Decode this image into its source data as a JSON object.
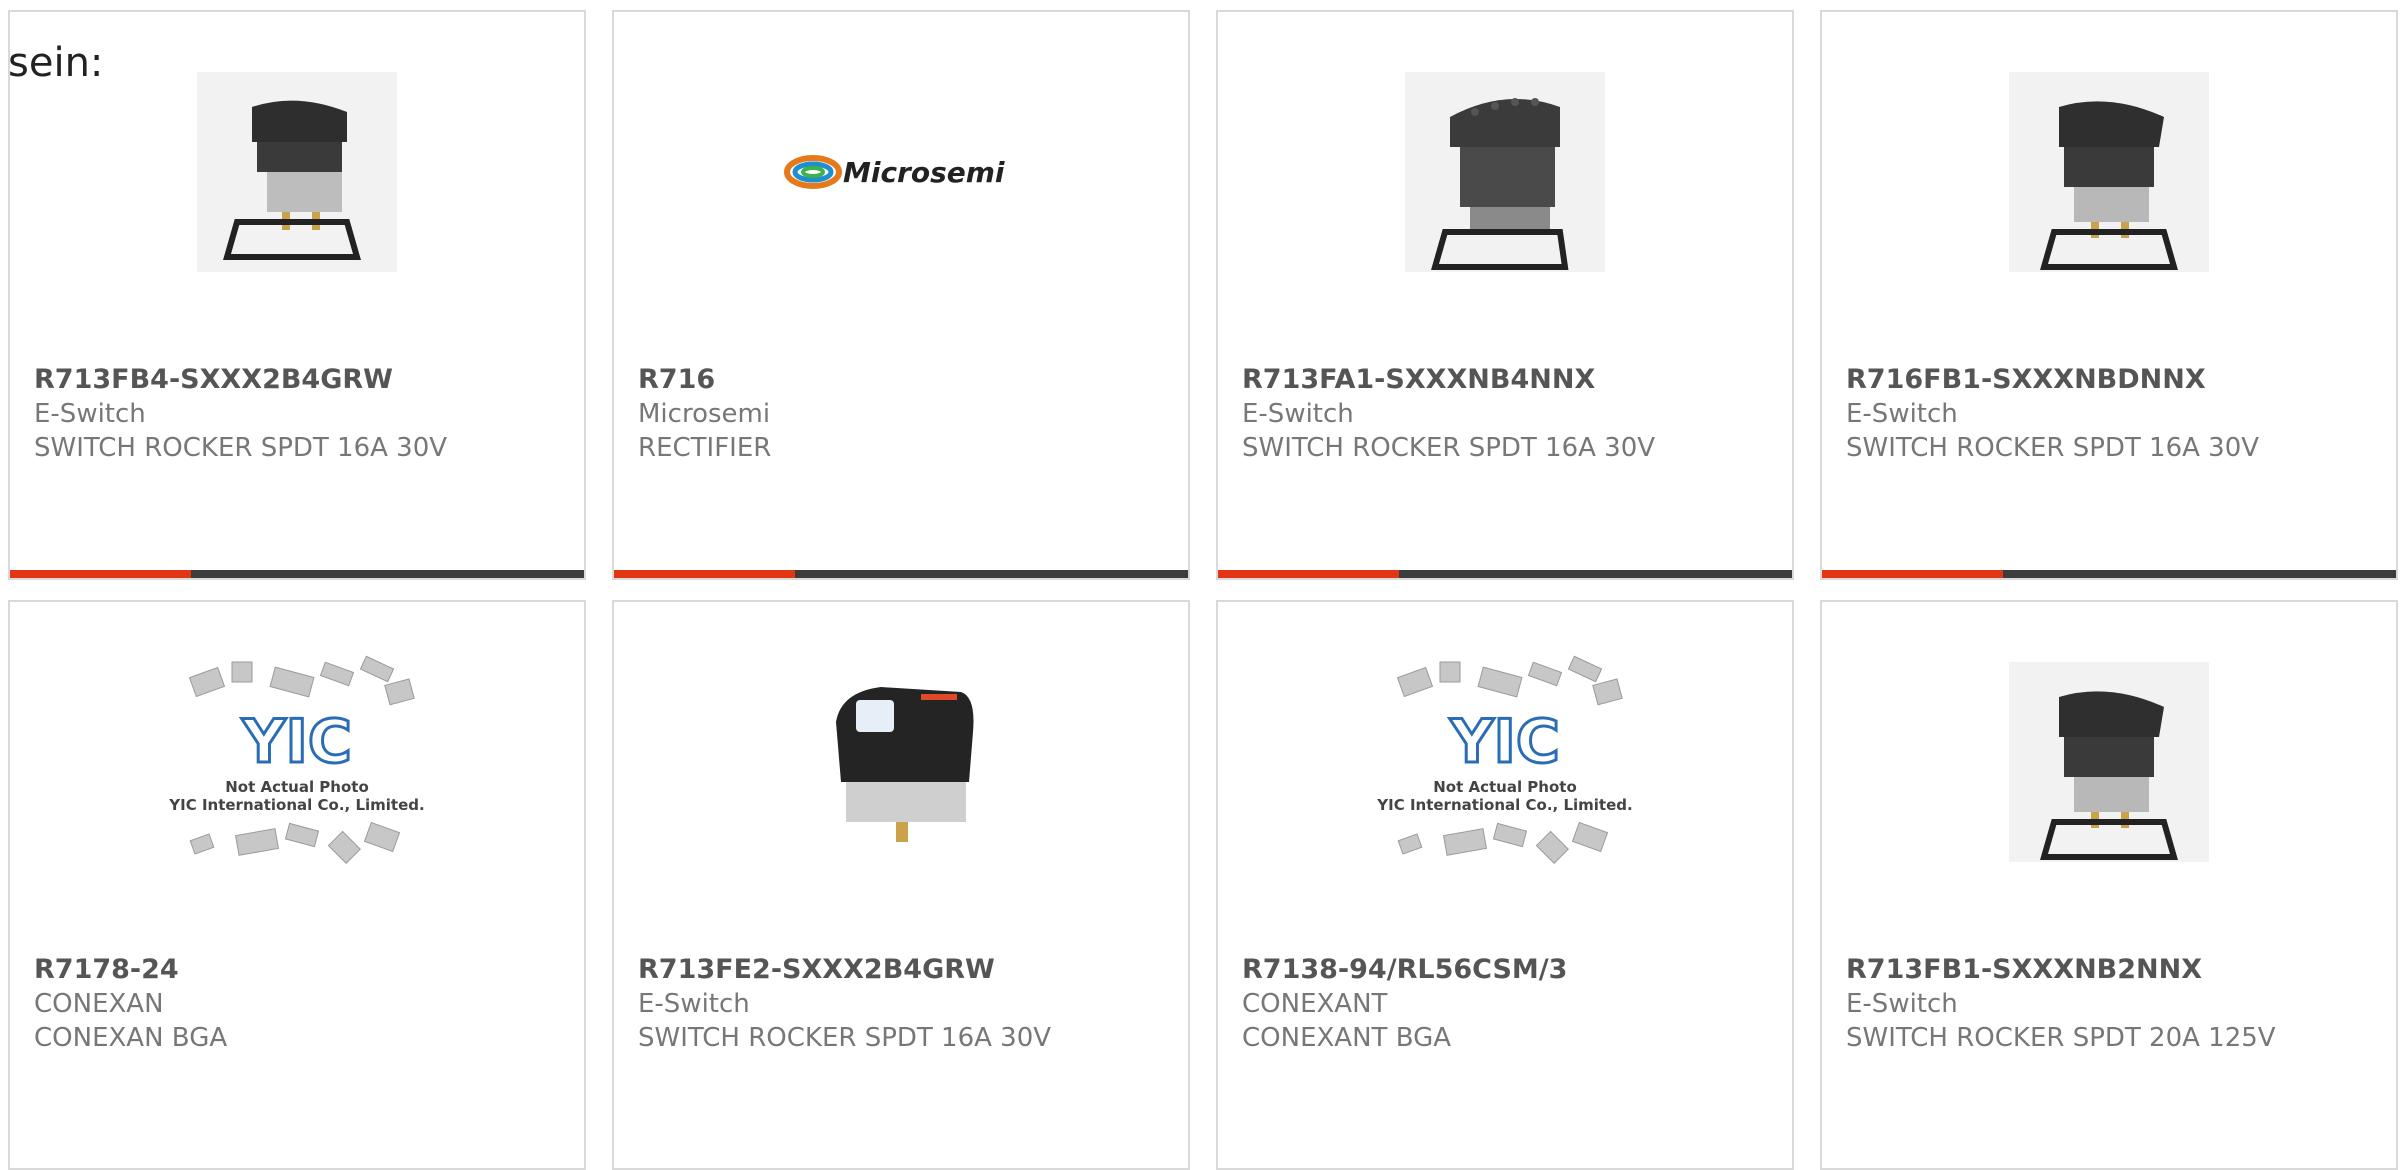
{
  "intro_text": "sein:",
  "colors": {
    "accent": "#e03614",
    "bar": "#3c3c3c",
    "border": "#d9d9d9"
  },
  "products": [
    {
      "part": "R713FB4-SXXX2B4GRW",
      "maker": "E-Switch",
      "desc": "SWITCH ROCKER SPDT 16A 30V",
      "image": "rocker-switch-with-gasket-icon"
    },
    {
      "part": "R716",
      "maker": "Microsemi",
      "desc": "RECTIFIER",
      "image": "microsemi-logo",
      "logo_text": "Microsemi"
    },
    {
      "part": "R713FA1-SXXXNB4NNX",
      "maker": "E-Switch",
      "desc": "SWITCH ROCKER SPDT 16A 30V",
      "image": "rocker-switch-with-gasket-icon"
    },
    {
      "part": "R716FB1-SXXXNBDNNX",
      "maker": "E-Switch",
      "desc": "SWITCH ROCKER SPDT 16A 30V",
      "image": "rocker-switch-with-gasket-icon"
    },
    {
      "part": "R7178-24",
      "maker": "CONEXAN",
      "desc": "CONEXAN BGA",
      "image": "yic-placeholder-icon",
      "placeholder_logo": "YIC",
      "placeholder_line1": "Not Actual Photo",
      "placeholder_line2": "YIC International Co., Limited."
    },
    {
      "part": "R713FE2-SXXX2B4GRW",
      "maker": "E-Switch",
      "desc": "SWITCH ROCKER SPDT 16A 30V",
      "image": "illuminated-rocker-switch-icon"
    },
    {
      "part": "R7138-94/RL56CSM/3",
      "maker": "CONEXANT",
      "desc": "CONEXANT BGA",
      "image": "yic-placeholder-icon",
      "placeholder_logo": "YIC",
      "placeholder_line1": "Not Actual Photo",
      "placeholder_line2": "YIC International Co., Limited."
    },
    {
      "part": "R713FB1-SXXXNB2NNX",
      "maker": "E-Switch",
      "desc": "SWITCH ROCKER SPDT 20A 125V",
      "image": "rocker-switch-with-gasket-icon"
    }
  ]
}
